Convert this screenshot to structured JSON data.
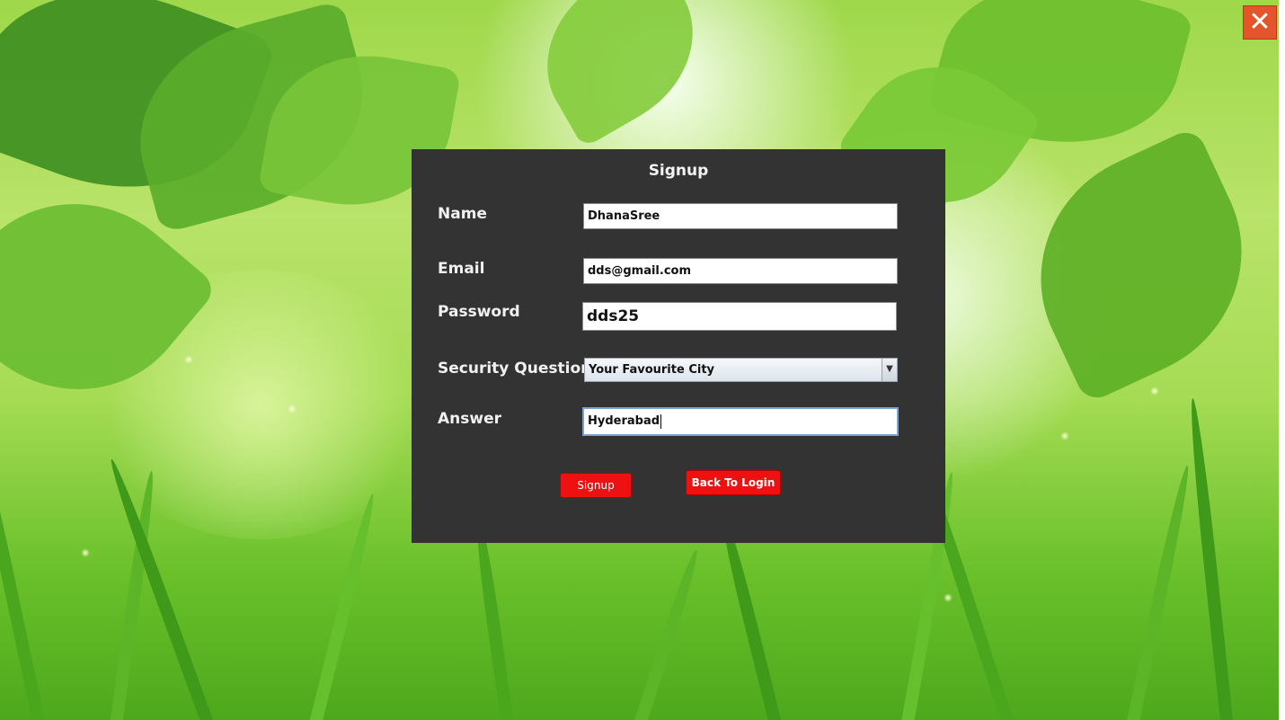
{
  "window": {
    "close_glyph": "✕"
  },
  "form": {
    "title": "Signup",
    "fields": {
      "name": {
        "label": "Name",
        "value": "DhanaSree"
      },
      "email": {
        "label": "Email",
        "value": "dds@gmail.com"
      },
      "password": {
        "label": "Password",
        "value": "dds25"
      },
      "security_question": {
        "label": "Security Question",
        "selected": "Your Favourite City"
      },
      "answer": {
        "label": "Answer",
        "value": "Hyderabad"
      }
    },
    "buttons": {
      "signup": "Signup",
      "back_to_login": "Back To Login"
    }
  },
  "colors": {
    "panel_bg": "#333333",
    "button_red": "#ee1111",
    "close_orange": "#e4552c"
  },
  "icons": {
    "close": "close-icon",
    "dropdown": "chevron-down-icon"
  }
}
